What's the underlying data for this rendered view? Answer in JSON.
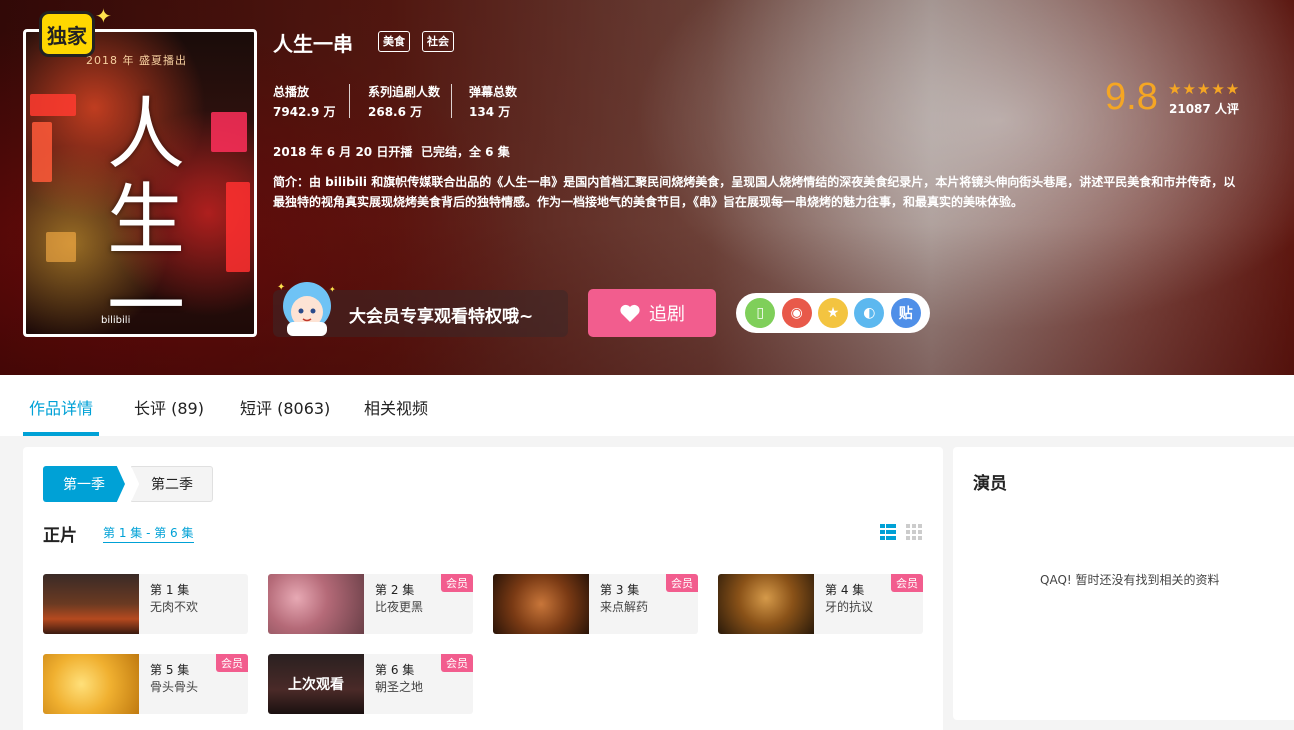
{
  "hero": {
    "exclusive_badge": "独家",
    "poster": {
      "top_text": "2018 年 盛夏播出",
      "title": "人生一串",
      "footer": "bilibili"
    },
    "title": "人生一串",
    "tags": [
      "美食",
      "社会"
    ],
    "stats": [
      {
        "label": "总播放",
        "value": "7942.9 万"
      },
      {
        "label": "系列追剧人数",
        "value": "268.6 万"
      },
      {
        "label": "弹幕总数",
        "value": "134 万"
      }
    ],
    "premiere": "2018 年 6 月 20 日开播",
    "status": "已完结，全 6 集",
    "description": "简介：由 bilibili 和旗帜传媒联合出品的《人生一串》是国内首档汇聚民间烧烤美食，呈现国人烧烤情结的深夜美食纪录片，本片将镜头伸向街头巷尾，讲述平民美食和市井传奇，以最独特的视角真实展现烧烤美食背后的独特情感。作为一档接地气的美食节目，《串》旨在展现每一串烧烤的魅力往事，和最真实的美味体验。",
    "rating": {
      "score": "9.8",
      "stars": "★★★★★",
      "count": "21087 人评"
    },
    "vip_text": "大会员专享观看特权哦~",
    "follow_label": "追剧",
    "share": [
      {
        "icon": "phone-icon",
        "label": "▯",
        "color": "#7fcf5a"
      },
      {
        "icon": "weibo-icon",
        "label": "◉",
        "color": "#e8594a"
      },
      {
        "icon": "qzone-icon",
        "label": "★",
        "color": "#f3c440"
      },
      {
        "icon": "qq-icon",
        "label": "◐",
        "color": "#5cb8ef"
      },
      {
        "icon": "tieba-icon",
        "label": "贴",
        "color": "#4f8fe8"
      }
    ]
  },
  "tabs": [
    {
      "label": "作品详情",
      "active": true
    },
    {
      "label": "长评 (89)",
      "active": false
    },
    {
      "label": "短评 (8063)",
      "active": false
    },
    {
      "label": "相关视频",
      "active": false
    }
  ],
  "main": {
    "seasons": [
      "第一季",
      "第二季"
    ],
    "section_title": "正片",
    "range": "第 1 集 - 第 6 集",
    "episodes": [
      {
        "num": "第 1 集",
        "name": "无肉不欢",
        "badge": "",
        "thumb": "grill"
      },
      {
        "num": "第 2 集",
        "name": "比夜更黑",
        "badge": "会员",
        "thumb": "meat"
      },
      {
        "num": "第 3 集",
        "name": "来点解药",
        "badge": "会员",
        "thumb": "lotus"
      },
      {
        "num": "第 4 集",
        "name": "牙的抗议",
        "badge": "会员",
        "thumb": "skewer"
      },
      {
        "num": "第 5 集",
        "name": "骨头骨头",
        "badge": "会员",
        "thumb": "chicken"
      },
      {
        "num": "第 6 集",
        "name": "朝圣之地",
        "badge": "会员",
        "thumb": "last",
        "overlay": "上次观看"
      }
    ]
  },
  "cast": {
    "title": "演员",
    "empty": "QAQ! 暂时还没有找到相关的资料"
  },
  "colors": {
    "accent": "#00a1d6",
    "pink": "#f25d8e",
    "rating": "#f5a623"
  }
}
